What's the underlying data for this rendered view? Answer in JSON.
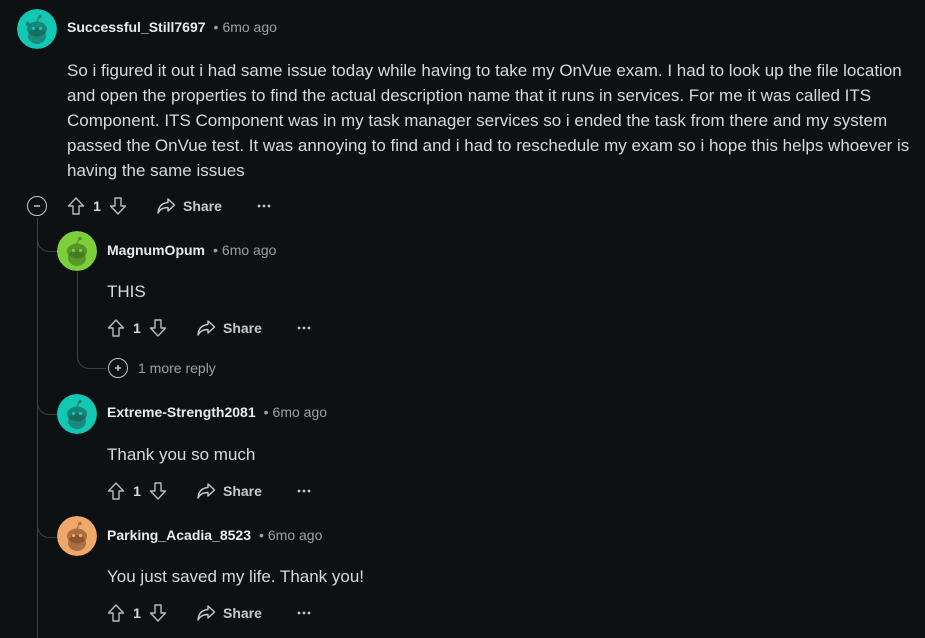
{
  "comments": [
    {
      "username": "Successful_Still7697",
      "time": "6mo ago",
      "body": "So i figured it out i had same issue today while having to take my OnVue exam. I had to look up the file location and open the properties to find the actual description name that it runs in services. For me it was called ITS Component. ITS Component was in my task manager services so i ended the task from there and my system passed the OnVue test. It was annoying to find and i had to reschedule my exam so i hope this helps whoever is having the same issues",
      "votes": "1",
      "avatar_color": "#12c7b3"
    },
    {
      "username": "MagnumOpum",
      "time": "6mo ago",
      "body": "THIS",
      "votes": "1",
      "avatar_color": "#7ccf3b"
    },
    {
      "username": "Extreme-Strength2081",
      "time": "6mo ago",
      "body": "Thank you so much",
      "votes": "1",
      "avatar_color": "#12c7b3"
    },
    {
      "username": "Parking_Acadia_8523",
      "time": "6mo ago",
      "body": "You just saved my life. Thank you!",
      "votes": "1",
      "avatar_color": "#f0a86a"
    }
  ],
  "labels": {
    "share": "Share",
    "more_replies": "1 more reply",
    "dot": "•"
  },
  "icons": {
    "upvote": "arrow-up-icon",
    "downvote": "arrow-down-icon",
    "share": "share-arrow-icon",
    "more": "ellipsis-icon",
    "collapse": "minus-circle-icon",
    "expand": "plus-circle-icon"
  }
}
